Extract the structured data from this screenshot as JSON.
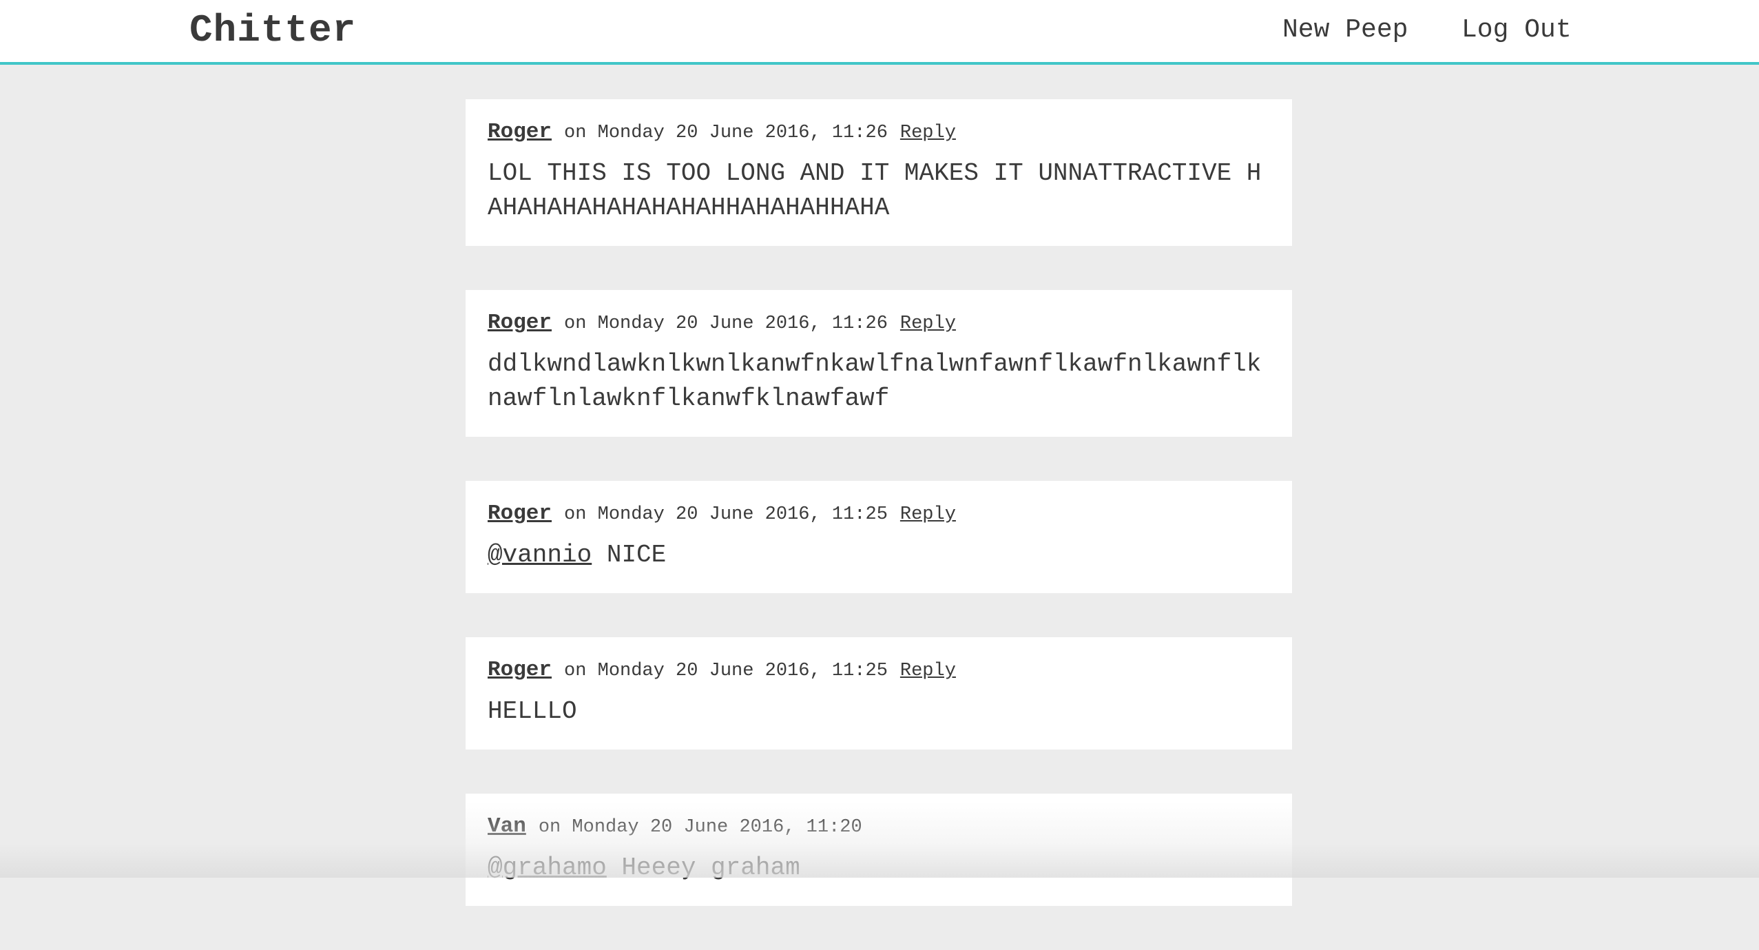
{
  "header": {
    "brand": "Chitter",
    "nav": {
      "new_peep": "New Peep",
      "log_out": "Log Out"
    }
  },
  "colors": {
    "accent": "#41c6c8",
    "background": "#ececec",
    "card": "#ffffff",
    "text": "#3a3a3a"
  },
  "peeps": [
    {
      "author": "Roger",
      "date": "on Monday 20 June 2016, 11:26",
      "reply": "Reply",
      "mention": "",
      "body": "LOL THIS IS TOO LONG AND IT MAKES IT UNNATTRACTIVE HAHAHAHAHAHAHAHAHHAHAHAHHAHA"
    },
    {
      "author": "Roger",
      "date": "on Monday 20 June 2016, 11:26",
      "reply": "Reply",
      "mention": "",
      "body": "ddlkwndlawknlkwnlkanwfnkawlfnalwnfawnflkawfnlkawnflknawflnlawknflkanwfklnawfawf"
    },
    {
      "author": "Roger",
      "date": "on Monday 20 June 2016, 11:25",
      "reply": "Reply",
      "mention": "@vannio",
      "body": " NICE"
    },
    {
      "author": "Roger",
      "date": "on Monday 20 June 2016, 11:25",
      "reply": "Reply",
      "mention": "",
      "body": "HELLLO"
    },
    {
      "author": "Van",
      "date": "on Monday 20 June 2016, 11:20",
      "reply": "",
      "mention": "@grahamo",
      "body": " Heeey graham"
    }
  ]
}
